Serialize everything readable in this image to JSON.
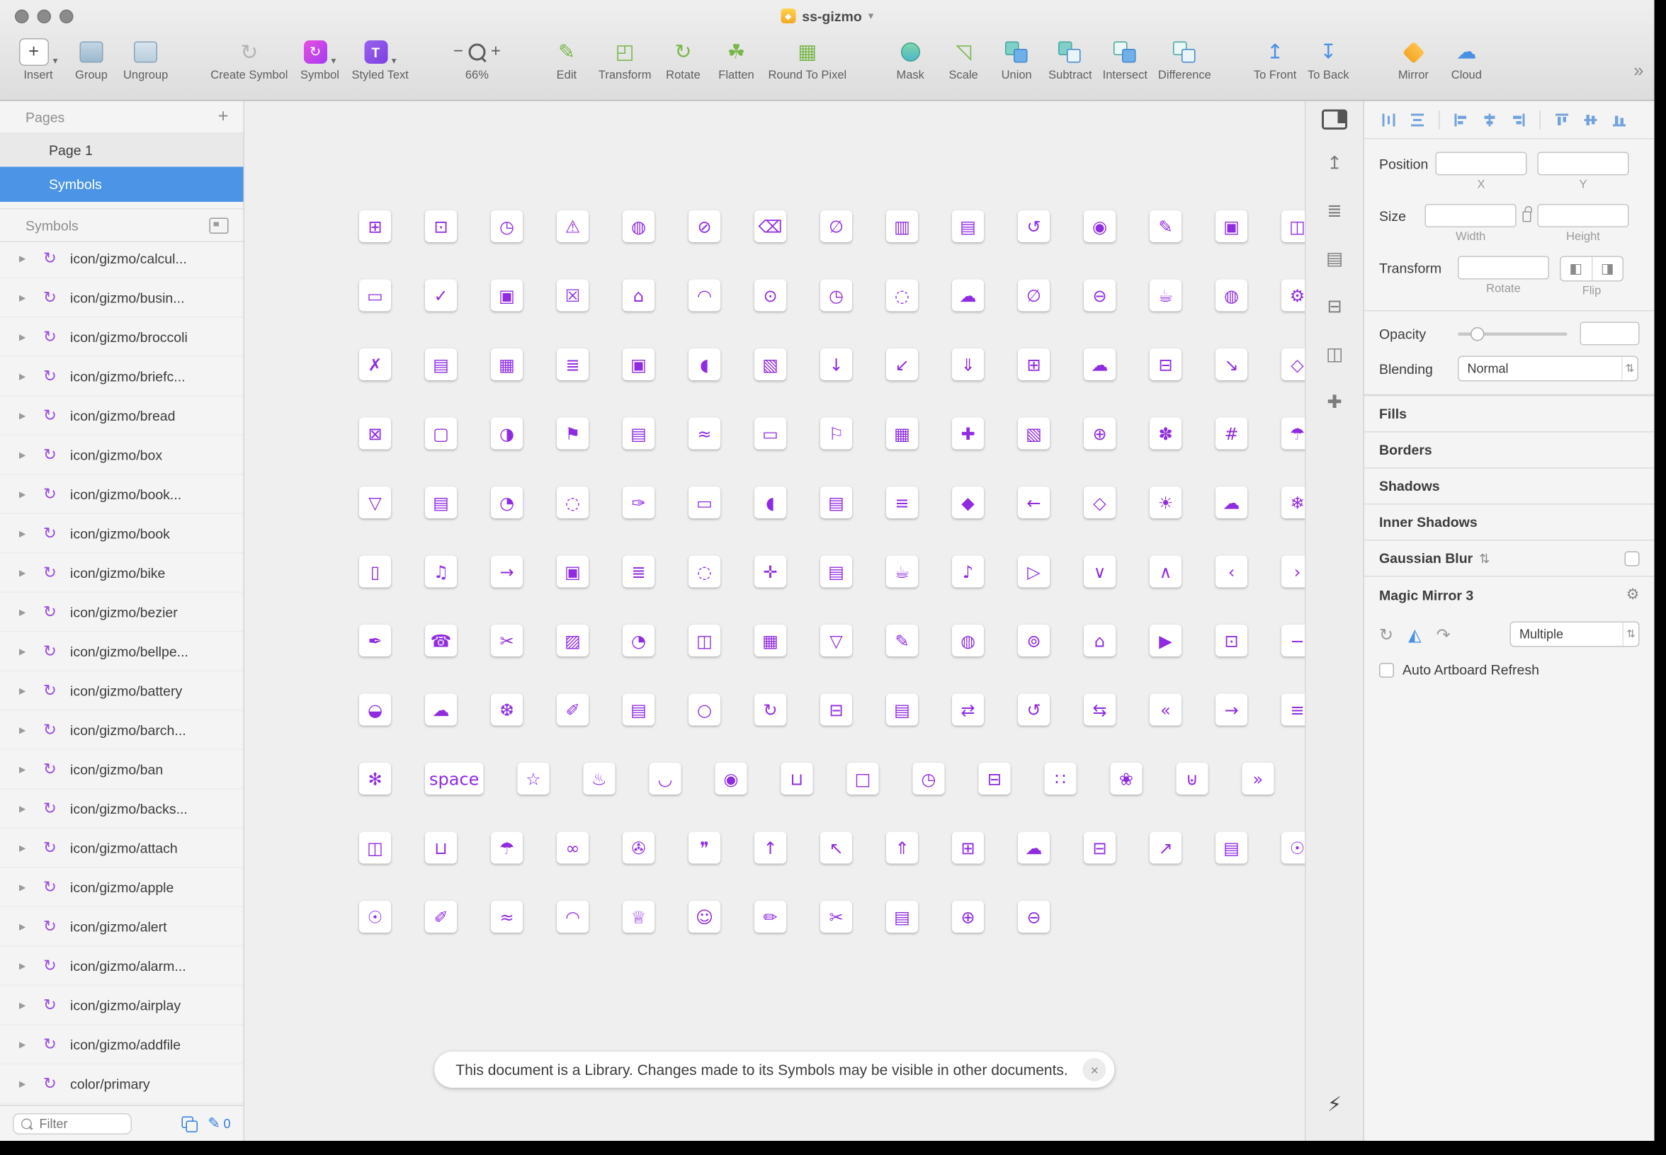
{
  "window": {
    "title": "ss-gizmo",
    "caret": "▾"
  },
  "toolbar": {
    "items": [
      {
        "label": "Insert",
        "icon": "plus-icon"
      },
      {
        "label": "Group",
        "icon": "group-cube-icon"
      },
      {
        "label": "Ungroup",
        "icon": "ungroup-cube-icon"
      },
      {
        "label": "Create Symbol",
        "icon": "symbol-loop-icon"
      },
      {
        "label": "Symbol",
        "icon": "symbol-badge-icon"
      },
      {
        "label": "Styled Text",
        "icon": "text-badge-icon"
      },
      {
        "label": "66%",
        "icon": "magnifier-icon"
      },
      {
        "label": "Edit",
        "icon": "pencil-icon"
      },
      {
        "label": "Transform",
        "icon": "transform-cube-icon"
      },
      {
        "label": "Rotate",
        "icon": "rotate-arrows-icon"
      },
      {
        "label": "Flatten",
        "icon": "leaf-icon"
      },
      {
        "label": "Round To Pixel",
        "icon": "pixel-grid-icon"
      },
      {
        "label": "Mask",
        "icon": "mask-circle-icon"
      },
      {
        "label": "Scale",
        "icon": "scale-arrow-icon"
      },
      {
        "label": "Union",
        "icon": "union-shapes-icon"
      },
      {
        "label": "Subtract",
        "icon": "subtract-shapes-icon"
      },
      {
        "label": "Intersect",
        "icon": "intersect-shapes-icon"
      },
      {
        "label": "Difference",
        "icon": "difference-shapes-icon"
      },
      {
        "label": "To Front",
        "icon": "arrow-to-front-icon"
      },
      {
        "label": "To Back",
        "icon": "arrow-to-back-icon"
      },
      {
        "label": "Mirror",
        "icon": "mirror-diamond-icon"
      },
      {
        "label": "Cloud",
        "icon": "cloud-icon"
      }
    ],
    "overflow_chevron": "»"
  },
  "sidebar": {
    "pages_header": "Pages",
    "add_page": "+",
    "pages": [
      {
        "label": "Page 1",
        "selected": false
      },
      {
        "label": "Symbols",
        "selected": true
      }
    ],
    "symbols_header": "Symbols",
    "symbols": [
      {
        "label": "icon/gizmo/calcul..."
      },
      {
        "label": "icon/gizmo/busin..."
      },
      {
        "label": "icon/gizmo/broccoli"
      },
      {
        "label": "icon/gizmo/briefc..."
      },
      {
        "label": "icon/gizmo/bread"
      },
      {
        "label": "icon/gizmo/box"
      },
      {
        "label": "icon/gizmo/book..."
      },
      {
        "label": "icon/gizmo/book"
      },
      {
        "label": "icon/gizmo/bike"
      },
      {
        "label": "icon/gizmo/bezier"
      },
      {
        "label": "icon/gizmo/bellpe..."
      },
      {
        "label": "icon/gizmo/battery"
      },
      {
        "label": "icon/gizmo/barch..."
      },
      {
        "label": "icon/gizmo/ban"
      },
      {
        "label": "icon/gizmo/backs..."
      },
      {
        "label": "icon/gizmo/attach"
      },
      {
        "label": "icon/gizmo/apple"
      },
      {
        "label": "icon/gizmo/alert"
      },
      {
        "label": "icon/gizmo/alarm..."
      },
      {
        "label": "icon/gizmo/airplay"
      },
      {
        "label": "icon/gizmo/addfile"
      },
      {
        "label": "color/primary"
      }
    ],
    "filter_placeholder": "Filter",
    "badge_count": "0",
    "pencil_glyph": "✎"
  },
  "canvas": {
    "rows": [
      [
        "⊞",
        "⊡",
        "◷",
        "⚠",
        "◍",
        "⊘",
        "⌫",
        "∅",
        "▥",
        "▤",
        "↺",
        "◉",
        "✎",
        "▣",
        "◫"
      ],
      [
        "▭",
        "✓",
        "▣",
        "☒",
        "⌂",
        "◠",
        "⊙",
        "◷",
        "◌",
        "☁",
        "∅",
        "⊖",
        "☕",
        "◍",
        "⚙"
      ],
      [
        "✗",
        "▤",
        "▦",
        "≣",
        "▣",
        "◖",
        "▧",
        "↓",
        "↙",
        "⇓",
        "⊞",
        "☁",
        "⊟",
        "↘",
        "◇"
      ],
      [
        "⊠",
        "▢",
        "◑",
        "⚑",
        "▤",
        "≈",
        "▭",
        "⚐",
        "▦",
        "✚",
        "▧",
        "⊕",
        "✽",
        "#",
        "☂"
      ],
      [
        "▽",
        "▤",
        "◔",
        "◌",
        "✑",
        "▭",
        "◖",
        "▤",
        "≡",
        "◆",
        "←",
        "◇",
        "☀",
        "☁",
        "❄"
      ],
      [
        "▯",
        "♫",
        "→",
        "▣",
        "≣",
        "◌",
        "✛",
        "▤",
        "☕",
        "♪",
        "▷",
        "∨",
        "∧",
        "‹",
        "›"
      ],
      [
        "✒",
        "☎",
        "✂",
        "▨",
        "◔",
        "◫",
        "▦",
        "▽",
        "✎",
        "◍",
        "⊚",
        "⌂",
        "▶",
        "⊡",
        "−"
      ],
      [
        "◒",
        "☁",
        "❆",
        "✐",
        "▤",
        "○",
        "↻",
        "⊟",
        "▤",
        "⇄",
        "↺",
        "⇆",
        "«",
        "→",
        "≡"
      ],
      [
        "✻",
        "space",
        "☆",
        "♨",
        "◡",
        "◉",
        "⊔",
        "□",
        "◷",
        "⊟",
        "∷",
        "❀",
        "⊎",
        "»"
      ],
      [
        "◫",
        "⊔",
        "☂",
        "∞",
        "✇",
        "❞",
        "↑",
        "↖",
        "⇑",
        "⊞",
        "☁",
        "⊟",
        "↗",
        "▤",
        "☉"
      ],
      [
        "☉",
        "✐",
        "≈",
        "◠",
        "♕",
        "☺",
        "✏",
        "✂",
        "▤",
        "⊕",
        "⊖"
      ]
    ],
    "notification": {
      "text": "This document is a Library. Changes made to its Symbols may be visible in other documents.",
      "close": "×"
    }
  },
  "inspector": {
    "position_label": "Position",
    "x_label": "X",
    "y_label": "Y",
    "size_label": "Size",
    "width_label": "Width",
    "height_label": "Height",
    "transform_label": "Transform",
    "rotate_label": "Rotate",
    "flip_label": "Flip",
    "opacity_label": "Opacity",
    "blending_label": "Blending",
    "blending_value": "Normal",
    "sections": [
      "Fills",
      "Borders",
      "Shadows",
      "Inner Shadows"
    ],
    "gaussian_label": "Gaussian Blur",
    "magic_mirror_label": "Magic Mirror 3",
    "mirror_dropdown_value": "Multiple",
    "auto_refresh_label": "Auto Artboard Refresh"
  },
  "icons": {
    "symbol-list-icon": "↻",
    "disclosure-icon": "▶",
    "share-icon": "↥",
    "print-icon": "≣",
    "card-view-icon": "▤",
    "list-view-icon": "⊟",
    "artboard-view-icon": "◫",
    "add-image-icon": "✚",
    "lightning-icon": "⚡",
    "refresh-icon": "↻",
    "flip-icon": "◭",
    "redo-icon": "↷",
    "stepper-icon": "⇅",
    "gear-icon": "⚙",
    "flip-h-icon": "◧",
    "flip-v-icon": "◨"
  }
}
